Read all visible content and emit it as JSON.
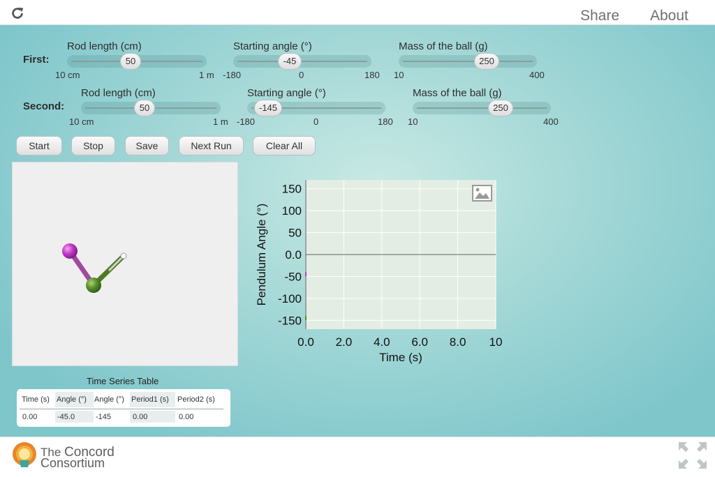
{
  "header": {
    "share": "Share",
    "about": "About"
  },
  "first": {
    "label": "First:",
    "rod": {
      "title": "Rod length (cm)",
      "value": "50",
      "min": "10 cm",
      "max": "1 m"
    },
    "angle": {
      "title": "Starting angle (°)",
      "value": "-45",
      "min": "-180",
      "mid": "0",
      "max": "180"
    },
    "mass": {
      "title": "Mass of the ball (g)",
      "value": "250",
      "min": "10",
      "max": "400"
    }
  },
  "second": {
    "label": "Second:",
    "rod": {
      "title": "Rod length (cm)",
      "value": "50",
      "min": "10 cm",
      "max": "1 m"
    },
    "angle": {
      "title": "Starting angle (°)",
      "value": "-145",
      "min": "-180",
      "mid": "0",
      "max": "180"
    },
    "mass": {
      "title": "Mass of the ball (g)",
      "value": "250",
      "min": "10",
      "max": "400"
    }
  },
  "buttons": {
    "start": "Start",
    "stop": "Stop",
    "save": "Save",
    "next_run": "Next Run",
    "clear_all": "Clear All"
  },
  "colors": {
    "pendulum1": "#c238c6",
    "pendulum2": "#5a8f2a",
    "accent": "#7fc6cb"
  },
  "chart_data": {
    "type": "line",
    "xlabel": "Time (s)",
    "ylabel": "Pendulum Angle (°)",
    "xlim": [
      0,
      10
    ],
    "ylim": [
      -170,
      170
    ],
    "xticks": [
      "0.0",
      "2.0",
      "4.0",
      "6.0",
      "8.0",
      "10"
    ],
    "yticks": [
      "150",
      "100",
      "50",
      "0.0",
      "-50",
      "-100",
      "-150"
    ],
    "grid": true,
    "series": []
  },
  "table": {
    "title": "Time Series Table",
    "headers": [
      "Time (s)",
      "Angle (°)",
      "Angle (°)",
      "Period1 (s)",
      "Period2 (s)"
    ],
    "row": [
      "0.00",
      "-45.0",
      "-145",
      "0.00",
      "0.00"
    ]
  },
  "footer": {
    "logo_line1_a": "The",
    "logo_line1_b": "Concord",
    "logo_line2": "Consortium"
  }
}
